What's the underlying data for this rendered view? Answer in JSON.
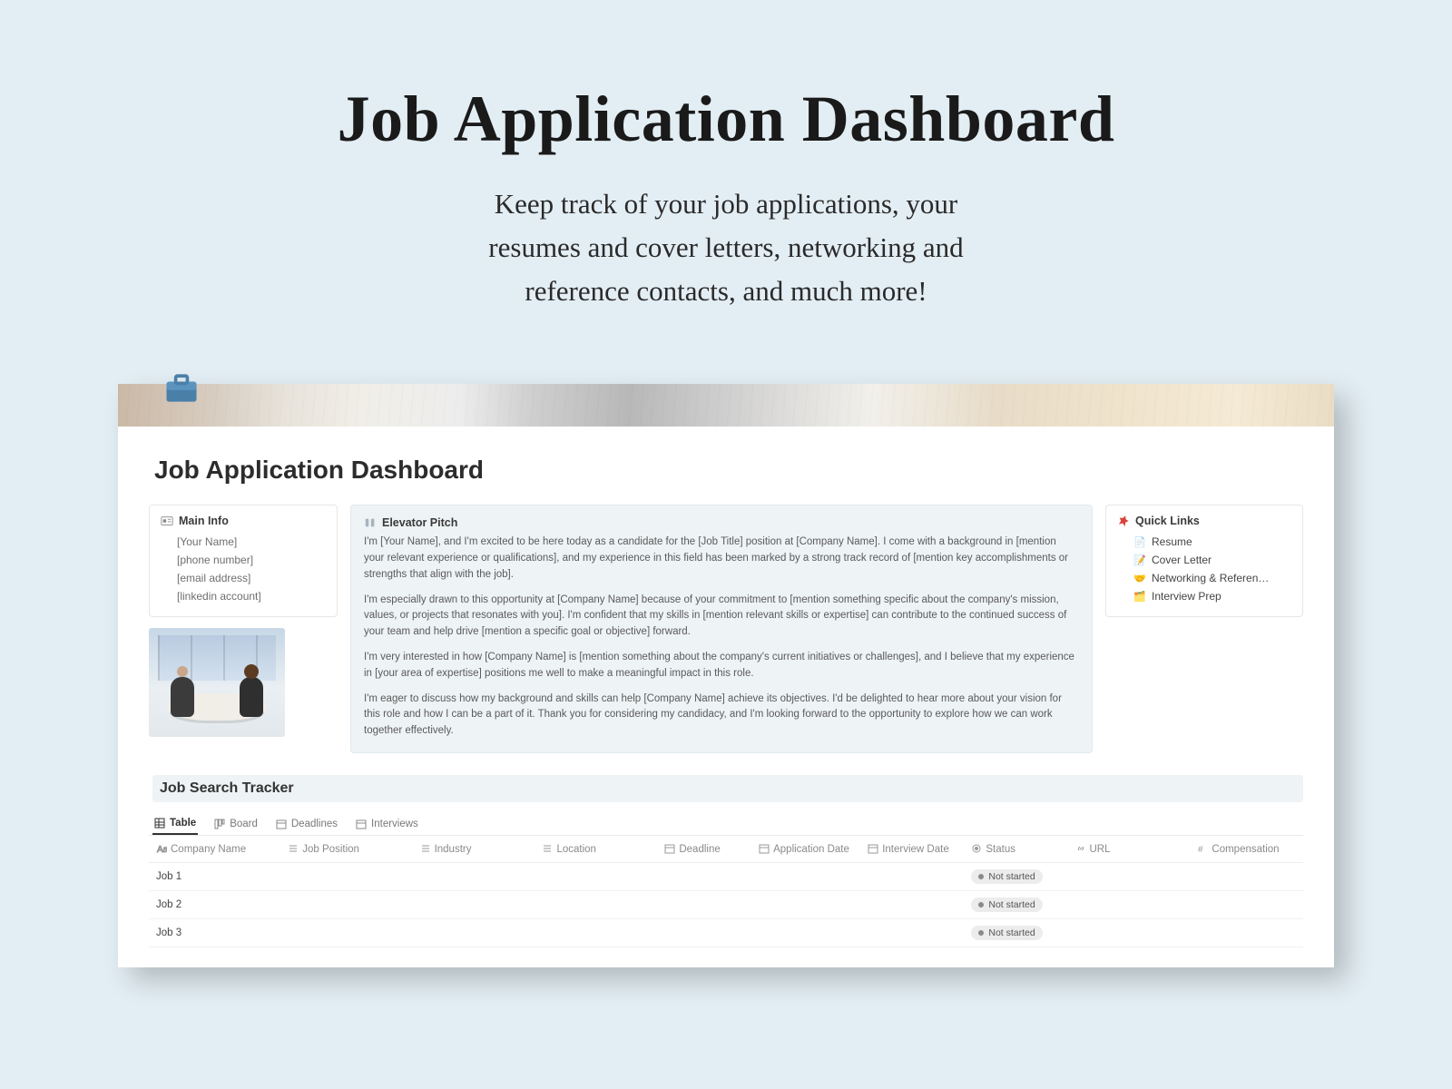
{
  "hero": {
    "title": "Job Application Dashboard",
    "subtitle_l1": "Keep track of your job applications, your",
    "subtitle_l2": "resumes and cover letters, networking and",
    "subtitle_l3": "reference contacts, and much more!"
  },
  "page": {
    "title": "Job Application Dashboard"
  },
  "main_info": {
    "heading": "Main Info",
    "items": [
      "[Your Name]",
      "[phone number]",
      "[email address]",
      "[linkedin account]"
    ]
  },
  "elevator_pitch": {
    "heading": "Elevator Pitch",
    "paragraphs": [
      "I'm [Your Name], and I'm excited to be here today as a candidate for the [Job Title] position at [Company Name]. I come with a background in [mention your relevant experience or qualifications], and my experience in this field has been marked by a strong track record of [mention key accomplishments or strengths that align with the job].",
      "I'm especially drawn to this opportunity at [Company Name] because of your commitment to [mention something specific about the company's mission, values, or projects that resonates with you]. I'm confident that my skills in [mention relevant skills or expertise] can contribute to the continued success of your team and help drive [mention a specific goal or objective] forward.",
      "I'm very interested in how [Company Name] is [mention something about the company's current initiatives or challenges], and I believe that my experience in [your area of expertise] positions me well to make a meaningful impact in this role.",
      "I'm eager to discuss how my background and skills can help [Company Name] achieve its objectives. I'd be delighted to hear more about your vision for this role and how I can be a part of it. Thank you for considering my candidacy, and I'm looking forward to the opportunity to explore how we can work together effectively."
    ]
  },
  "quick_links": {
    "heading": "Quick Links",
    "items": [
      {
        "emoji": "📄",
        "label": "Resume"
      },
      {
        "emoji": "📝",
        "label": "Cover Letter"
      },
      {
        "emoji": "🤝",
        "label": "Networking & Referen…"
      },
      {
        "emoji": "🗂️",
        "label": "Interview Prep"
      }
    ]
  },
  "tracker": {
    "title": "Job Search Tracker",
    "tabs": [
      {
        "label": "Table",
        "icon": "table",
        "active": true
      },
      {
        "label": "Board",
        "icon": "board",
        "active": false
      },
      {
        "label": "Deadlines",
        "icon": "calendar",
        "active": false
      },
      {
        "label": "Interviews",
        "icon": "calendar",
        "active": false
      }
    ],
    "columns": [
      {
        "label": "Company Name",
        "icon": "text"
      },
      {
        "label": "Job Position",
        "icon": "list"
      },
      {
        "label": "Industry",
        "icon": "list"
      },
      {
        "label": "Location",
        "icon": "list"
      },
      {
        "label": "Deadline",
        "icon": "calendar"
      },
      {
        "label": "Application Date",
        "icon": "calendar"
      },
      {
        "label": "Interview Date",
        "icon": "calendar"
      },
      {
        "label": "Status",
        "icon": "status"
      },
      {
        "label": "URL",
        "icon": "link"
      },
      {
        "label": "Compensation",
        "icon": "number"
      }
    ],
    "rows": [
      {
        "name": "Job 1",
        "status": "Not started"
      },
      {
        "name": "Job 2",
        "status": "Not started"
      },
      {
        "name": "Job 3",
        "status": "Not started"
      }
    ]
  }
}
